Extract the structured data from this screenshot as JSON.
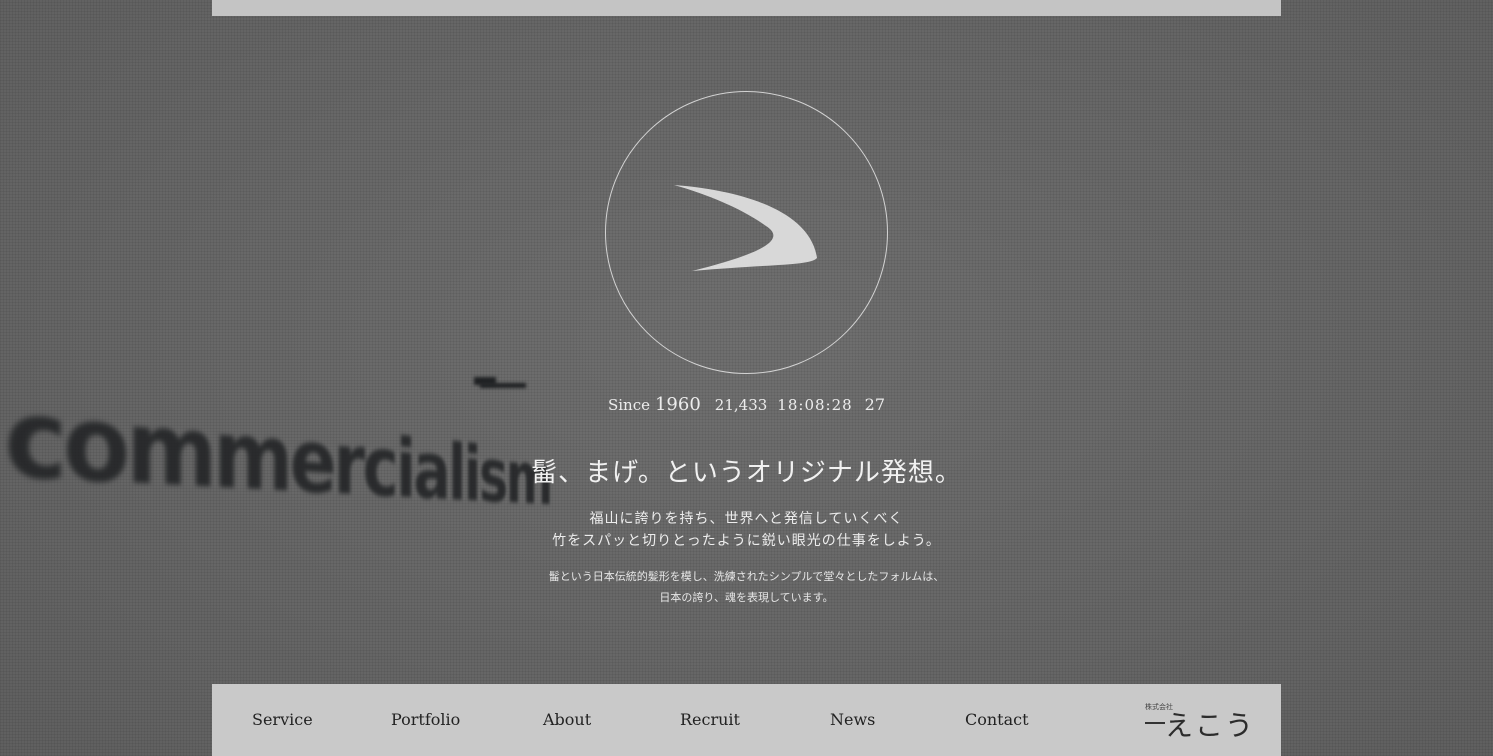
{
  "hero": {
    "background_word": "commercialism",
    "since_label": "Since",
    "since_year": "1960",
    "counter_days": "21,433",
    "counter_time": "18:08:28",
    "counter_extra": "27",
    "headline": "髷、まげ。というオリジナル発想。",
    "lead_lines": [
      "福山に誇りを持ち、世界へと発信していくべく",
      "竹をスパッと切りとったように鋭い眼光の仕事をしよう。"
    ],
    "sub_lines": [
      "髷という日本伝統的髪形を模し、洗練されたシンプルで堂々としたフォルムは、",
      "日本の誇り、魂を表現しています。"
    ],
    "logo_icon": "mage-topknot-logo-icon"
  },
  "nav": {
    "items": [
      {
        "label": "Service"
      },
      {
        "label": "Portfolio"
      },
      {
        "label": "About"
      },
      {
        "label": "Recruit"
      },
      {
        "label": "News"
      },
      {
        "label": "Contact"
      }
    ],
    "brand_small": "株式会社",
    "brand_name": "えこう"
  },
  "colors": {
    "background": "#6b6b6b",
    "panel": "#c9c9c9",
    "text_light": "#f1f1f1",
    "nav_text": "#222222"
  }
}
